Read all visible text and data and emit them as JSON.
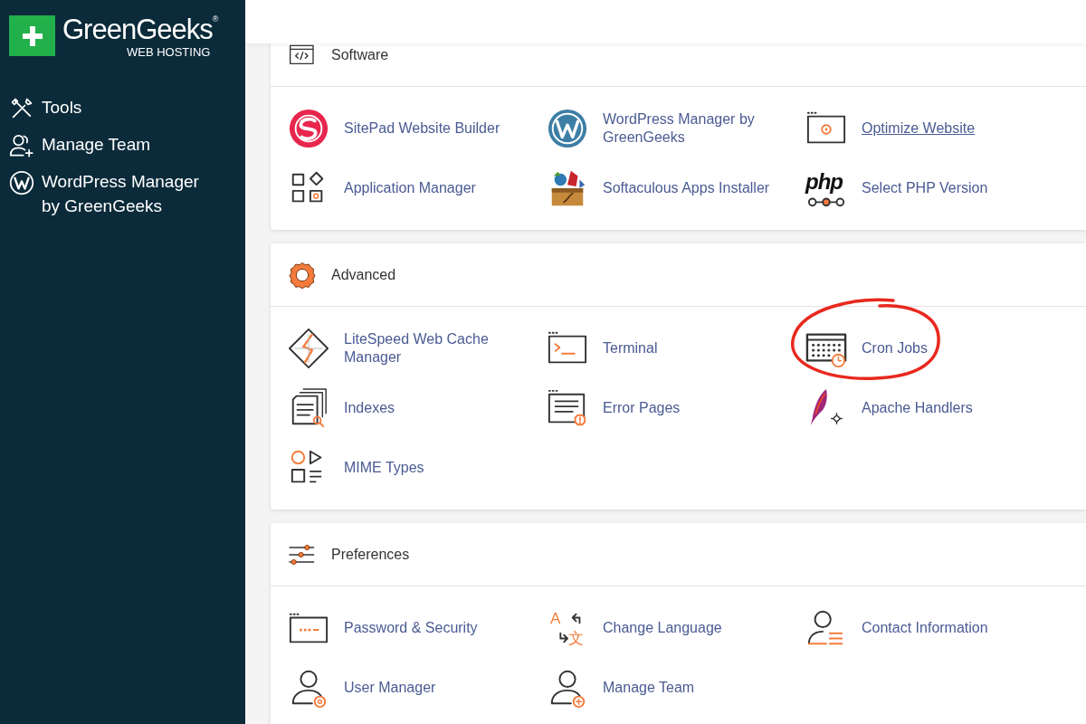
{
  "sidebar": {
    "logo": {
      "name": "GreenGeeks",
      "registered": "®",
      "tagline": "WEB HOSTING"
    },
    "items": [
      {
        "label": "Tools",
        "kind": "tools"
      },
      {
        "label": "Manage Team",
        "kind": "team"
      },
      {
        "label": "WordPress Manager by GreenGeeks",
        "kind": "wordpress"
      }
    ]
  },
  "sections": [
    {
      "title": "Software",
      "kind": "code",
      "items": [
        {
          "label": "SitePad Website Builder",
          "kind": "sitepad",
          "hovered": false,
          "circled": false
        },
        {
          "label": "WordPress Manager by GreenGeeks",
          "kind": "wordpress",
          "hovered": false,
          "circled": false
        },
        {
          "label": "Optimize Website",
          "kind": "optimize",
          "hovered": true,
          "circled": false
        },
        {
          "label": "Application Manager",
          "kind": "apps",
          "hovered": false,
          "circled": false
        },
        {
          "label": "Softaculous Apps Installer",
          "kind": "softaculous",
          "hovered": false,
          "circled": false
        },
        {
          "label": "Select PHP Version",
          "kind": "php",
          "icon_text": "php",
          "hovered": false,
          "circled": false
        }
      ]
    },
    {
      "title": "Advanced",
      "kind": "gear",
      "items": [
        {
          "label": "LiteSpeed Web Cache Manager",
          "kind": "litespeed",
          "hovered": false,
          "circled": false
        },
        {
          "label": "Terminal",
          "kind": "terminal",
          "hovered": false,
          "circled": false
        },
        {
          "label": "Cron Jobs",
          "kind": "cron",
          "hovered": false,
          "circled": true
        },
        {
          "label": "Indexes",
          "kind": "indexes",
          "hovered": false,
          "circled": false
        },
        {
          "label": "Error Pages",
          "kind": "errorpages",
          "hovered": false,
          "circled": false
        },
        {
          "label": "Apache Handlers",
          "kind": "apache",
          "hovered": false,
          "circled": false
        },
        {
          "label": "MIME Types",
          "kind": "mime",
          "hovered": false,
          "circled": false
        }
      ]
    },
    {
      "title": "Preferences",
      "kind": "sliders",
      "items": [
        {
          "label": "Password & Security",
          "kind": "password",
          "hovered": false,
          "circled": false
        },
        {
          "label": "Change Language",
          "kind": "language",
          "icon_text": [
            "A",
            "文"
          ],
          "hovered": false,
          "circled": false
        },
        {
          "label": "Contact Information",
          "kind": "contact",
          "hovered": false,
          "circled": false
        },
        {
          "label": "User Manager",
          "kind": "usermanager",
          "hovered": false,
          "circled": false
        },
        {
          "label": "Manage Team",
          "kind": "manageteam",
          "hovered": false,
          "circled": false
        }
      ]
    }
  ]
}
